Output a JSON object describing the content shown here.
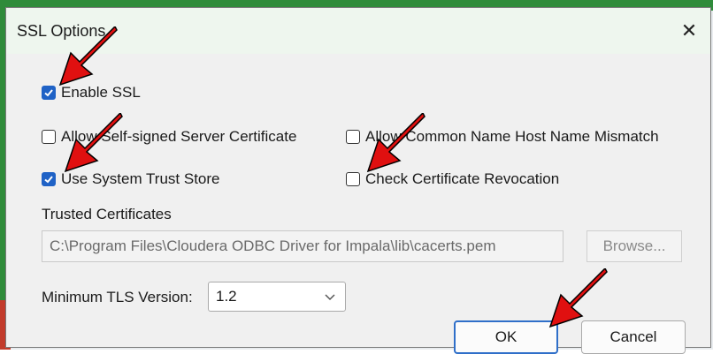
{
  "dialog": {
    "title": "SSL Options",
    "close_glyph": "✕"
  },
  "options": {
    "enable_ssl": {
      "label": "Enable SSL",
      "checked": true
    },
    "allow_self_signed": {
      "label": "Allow Self-signed Server Certificate",
      "checked": false
    },
    "allow_cn_mismatch": {
      "label": "Allow Common Name Host Name Mismatch",
      "checked": false
    },
    "use_system_trust_store": {
      "label": "Use System Trust Store",
      "checked": true
    },
    "check_revocation": {
      "label": "Check Certificate Revocation",
      "checked": false
    }
  },
  "trusted_certificates": {
    "label": "Trusted Certificates",
    "path_value": "C:\\Program Files\\Cloudera ODBC Driver for Impala\\lib\\cacerts.pem",
    "browse_label": "Browse..."
  },
  "tls": {
    "label": "Minimum TLS Version:",
    "selected": "1.2"
  },
  "buttons": {
    "ok": "OK",
    "cancel": "Cancel"
  },
  "colors": {
    "accent": "#1f62c6",
    "annotation_arrow": "#e01010"
  }
}
